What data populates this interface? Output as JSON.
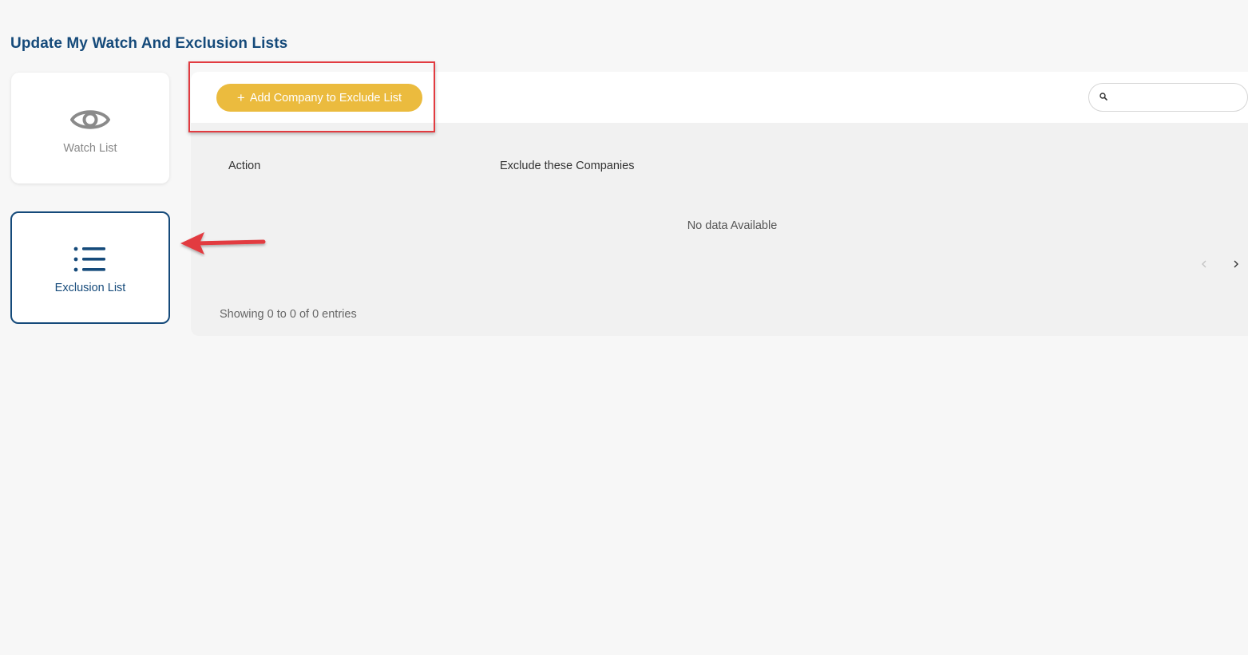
{
  "page": {
    "title": "Update My Watch And Exclusion Lists"
  },
  "sidebar": {
    "cards": [
      {
        "label": "Watch List",
        "icon": "eye-icon"
      },
      {
        "label": "Exclusion List",
        "icon": "list-icon",
        "active": true
      }
    ]
  },
  "toolbar": {
    "add_button_plus": "+",
    "add_button_label": "Add Company to Exclude List",
    "search_placeholder": ""
  },
  "table": {
    "columns": [
      "Action",
      "Exclude these Companies"
    ],
    "empty_message": "No data Available",
    "info": "Showing 0 to 0 of 0 entries"
  },
  "colors": {
    "primary": "#154a7a",
    "accent": "#ebbb3e",
    "annotation": "#e23b40"
  }
}
